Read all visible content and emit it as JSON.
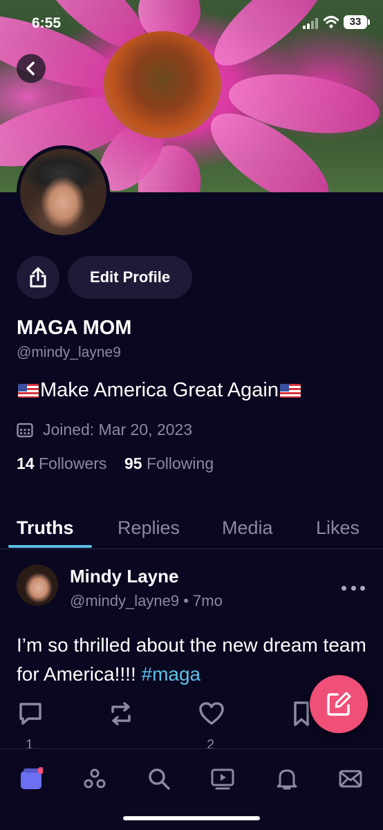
{
  "status_bar": {
    "time": "6:55",
    "battery": "33"
  },
  "profile": {
    "edit_label": "Edit Profile",
    "display_name": "MAGA MOM",
    "handle": "@mindy_layne9",
    "bio": "Make America Great Again",
    "joined": "Joined: Mar 20, 2023",
    "followers_count": "14",
    "followers_label": "Followers",
    "following_count": "95",
    "following_label": "Following"
  },
  "tabs": [
    {
      "label": "Truths",
      "active": true
    },
    {
      "label": "Replies",
      "active": false
    },
    {
      "label": "Media",
      "active": false
    },
    {
      "label": "Likes",
      "active": false
    }
  ],
  "post": {
    "author_name": "Mindy Layne",
    "author_handle": "@mindy_layne9",
    "separator": "•",
    "time": "7mo",
    "text": "I’m so thrilled about the new dream team for America!!!! ",
    "hashtag": "#maga",
    "reply_count": "1",
    "like_count": "2"
  },
  "icons": {
    "back": "chevron-left-icon",
    "share": "share-icon",
    "calendar": "calendar-icon",
    "more": "more-horizontal-icon",
    "reply": "comment-icon",
    "retruth": "repost-icon",
    "like": "heart-icon",
    "bookmark": "bookmark-icon",
    "compose": "compose-icon",
    "nav": [
      "home-icon",
      "groups-icon",
      "search-icon",
      "video-icon",
      "bell-icon",
      "mail-icon"
    ]
  },
  "colors": {
    "background": "#0a0720",
    "accent": "#5bc2e7",
    "fab": "#f04f78",
    "nav_active": "#6b6ff0"
  }
}
